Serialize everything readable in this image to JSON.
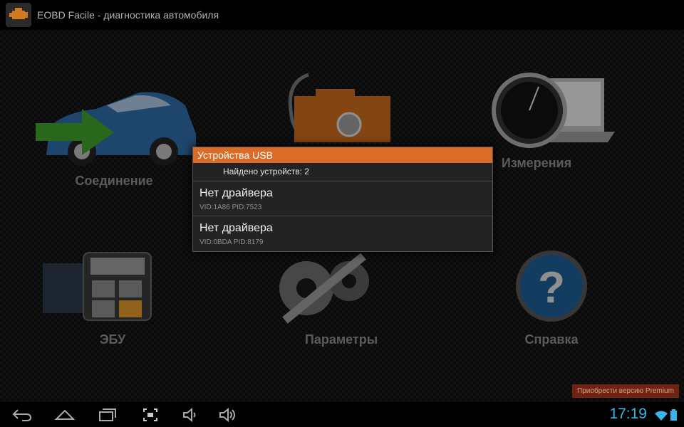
{
  "window": {
    "title": "EOBD Facile - диагностика автомобиля"
  },
  "menu": {
    "tiles": [
      {
        "label": "Соединение",
        "icon": "car-arrow-icon"
      },
      {
        "label": "",
        "icon": "engine-stethoscope-icon"
      },
      {
        "label": "Измерения",
        "icon": "gauge-laptop-icon"
      },
      {
        "label": "ЭБУ",
        "icon": "ecu-calculator-icon"
      },
      {
        "label": "Параметры",
        "icon": "gears-wrench-icon"
      },
      {
        "label": "Справка",
        "icon": "help-question-icon"
      }
    ]
  },
  "dialog": {
    "title": "Устройства USB",
    "count_text": "Найдено устройств: 2",
    "devices": [
      {
        "name": "Нет драйвера",
        "ids": "VID:1A86 PID:7523"
      },
      {
        "name": "Нет драйвера",
        "ids": "VID:0BDA PID:8179"
      }
    ]
  },
  "premium": {
    "label": "Приобрести версию Premium"
  },
  "statusbar": {
    "time": "17:19"
  },
  "colors": {
    "accent": "#dc6b27",
    "clock": "#38b6ea"
  }
}
